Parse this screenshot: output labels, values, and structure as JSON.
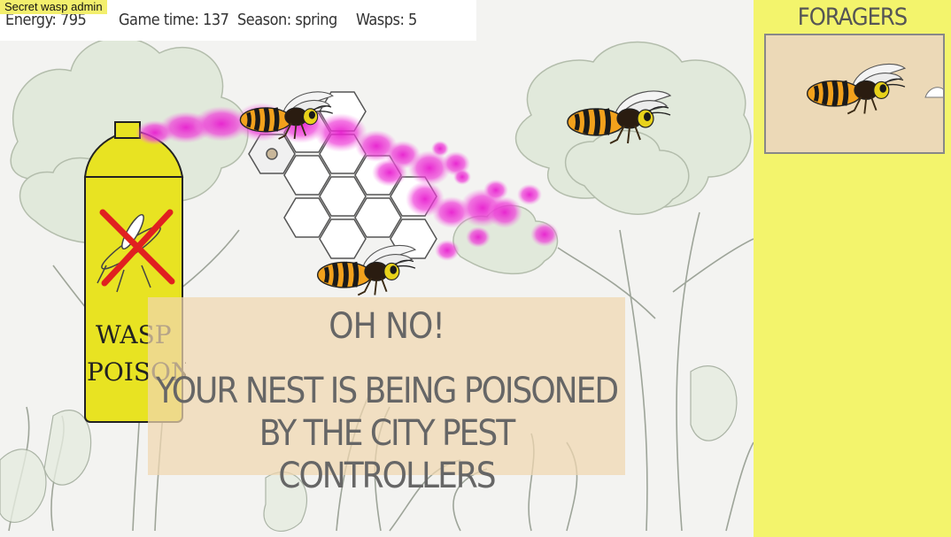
{
  "admin_button": "Secret wasp admin",
  "stats": {
    "energy": "Energy: 795",
    "game_time": "Game time: 137",
    "season": "Season: spring",
    "wasps": "Wasps: 5"
  },
  "panel": {
    "title": "FORAGERS",
    "background": "#f3f46c",
    "card_background": "#ecd9b7"
  },
  "overlay": {
    "title": "OH NO!",
    "message": "YOUR NEST IS BEING POISONED BY THE CITY PEST CONTROLLERS"
  },
  "spray_can": {
    "label_line1": "WASP",
    "label_line2": "POISON",
    "color": "#e8e322"
  },
  "poison_color": "#e81ecf",
  "icons": [
    "wasp-icon",
    "spray-can-icon",
    "no-mosquito-icon",
    "hex-nest-icon",
    "tree-icon"
  ]
}
